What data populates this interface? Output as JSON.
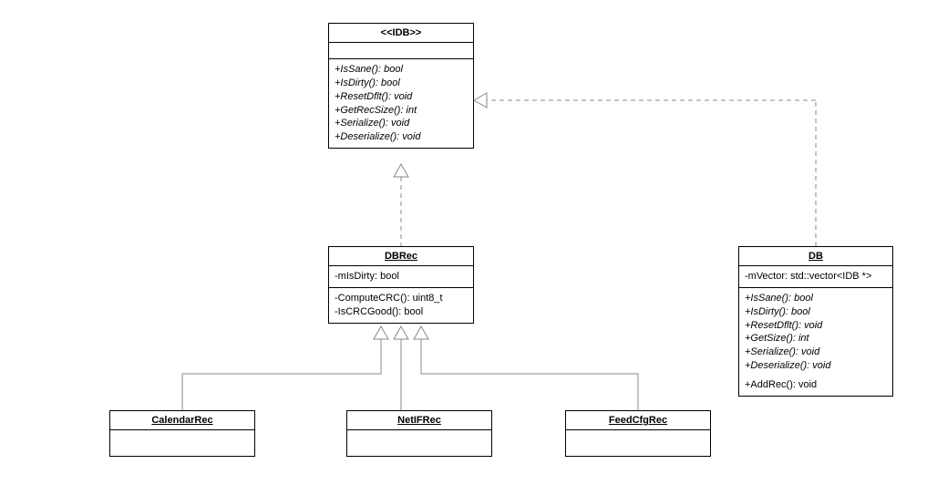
{
  "idb": {
    "stereotype": "<<IDB>>",
    "methods": [
      "+IsSane(): bool",
      "+IsDirty(): bool",
      "+ResetDflt(): void",
      "+GetRecSize(): int",
      "+Serialize(): void",
      "+Deserialize(): void"
    ]
  },
  "dbrec": {
    "name": "DBRec",
    "attrs": [
      "-mIsDirty: bool"
    ],
    "methods": [
      "-ComputeCRC(): uint8_t",
      "-IsCRCGood(): bool"
    ]
  },
  "db": {
    "name": "DB",
    "attrs": [
      "-mVector: std::vector<IDB *>"
    ],
    "methods_italic": [
      "+IsSane(): bool",
      "+IsDirty(): bool",
      "+ResetDflt(): void",
      "+GetSize(): int",
      "+Serialize(): void",
      "+Deserialize(): void"
    ],
    "methods_plain": [
      "+AddRec(): void"
    ]
  },
  "calendarrec": {
    "name": "CalendarRec"
  },
  "netifrec": {
    "name": "NetIFRec"
  },
  "feedcfgrec": {
    "name": "FeedCfgRec"
  }
}
